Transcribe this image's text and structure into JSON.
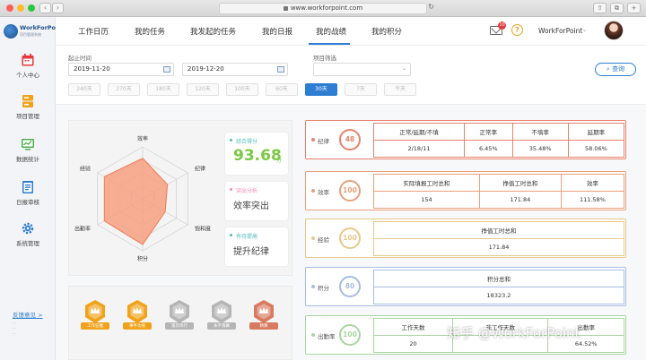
{
  "browser": {
    "url": "www.workforpoint.com"
  },
  "sidebar": {
    "logo_title": "WorkForPoint",
    "logo_subtitle": "项目管理系统",
    "items": [
      {
        "label": "个人中心",
        "icon": "calendar-icon"
      },
      {
        "label": "项目管理",
        "icon": "project-icon"
      },
      {
        "label": "数据统计",
        "icon": "chart-icon"
      },
      {
        "label": "日报审核",
        "icon": "report-icon"
      },
      {
        "label": "系统管理",
        "icon": "gear-icon"
      }
    ],
    "feedback": "反馈意见 >"
  },
  "header": {
    "tabs": [
      "工作日历",
      "我的任务",
      "我发起的任务",
      "我的日报",
      "我的战绩",
      "我的积分"
    ],
    "active_tab": "我的战绩",
    "mail_badge": "10",
    "help": "?",
    "user_name": "WorkForPoint",
    "caret": "⌄"
  },
  "filter": {
    "date_label": "起止时间",
    "start_date": "2019-11-20",
    "end_date": "2019-12-20",
    "project_label": "项目筛选",
    "search_button": "查询",
    "chips": [
      "240天",
      "270天",
      "180天",
      "120天",
      "100天",
      "60天",
      "30天",
      "7天",
      "今天"
    ],
    "active_chip": "30天"
  },
  "radar": {
    "axes": [
      "效率",
      "纪律",
      "饱和度",
      "积分",
      "出勤率",
      "经验"
    ],
    "values": [
      0.78,
      0.55,
      0.5,
      0.88,
      0.85,
      0.85
    ],
    "fill_color": "#f7a080",
    "stroke_color": "#f07a55"
  },
  "summary": {
    "score_label": "综合得分",
    "score_value": "93.68",
    "score_unit": "分",
    "strength_label": "突出分析",
    "strength_value": "效率突出",
    "improve_label": "有待提高",
    "improve_value": "提升纪律"
  },
  "medals": [
    {
      "label": "工作狂魔",
      "color": "#f0a21b"
    },
    {
      "label": "事半功倍",
      "color": "#f0a21b"
    },
    {
      "label": "雷厉风行",
      "color": "#b5b5b5"
    },
    {
      "label": "永不落幕",
      "color": "#b5b5b5"
    },
    {
      "label": "精算",
      "color": "#d77a5f"
    }
  ],
  "metrics": [
    {
      "name": "纪律",
      "score": "48",
      "color": "#e7826b",
      "headers": [
        "正常/延期/不填",
        "正常率",
        "不填率",
        "延期率"
      ],
      "values": [
        "2/18/11",
        "6.45%",
        "35.48%",
        "58.06%"
      ]
    },
    {
      "name": "效率",
      "score": "100",
      "color": "#e8a07c",
      "headers": [
        "实际填报工时总和",
        "挣值工时总和",
        "效率"
      ],
      "values": [
        "154",
        "171.84",
        "111.58%"
      ]
    },
    {
      "name": "经验",
      "score": "100",
      "color": "#e8c88a",
      "headers": [
        "挣值工时总和"
      ],
      "values": [
        "171.84"
      ]
    },
    {
      "name": "积分",
      "score": "80",
      "color": "#a6bde0",
      "headers": [
        "积分总和"
      ],
      "values": [
        "18323.2"
      ]
    },
    {
      "name": "出勤率",
      "score": "100",
      "color": "#a8d5a0",
      "headers": [
        "工作天数",
        "非工作天数",
        "出勤率"
      ],
      "values": [
        "20",
        "",
        "64.52%"
      ]
    }
  ],
  "watermark": "知乎 @WorkForPoint"
}
